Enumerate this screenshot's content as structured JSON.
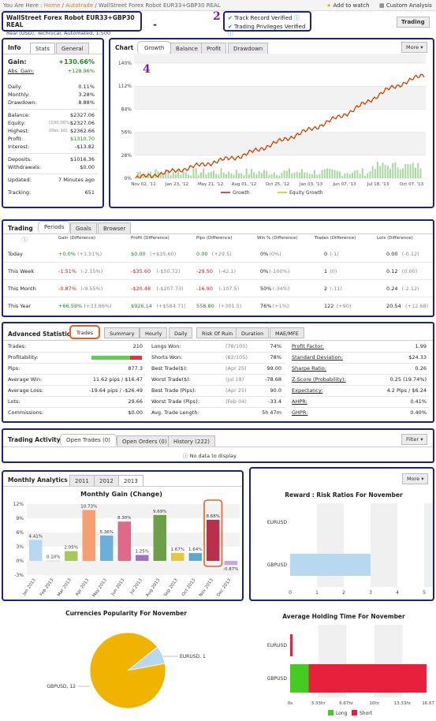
{
  "breadcrumb": {
    "prefix": "You Are Here :",
    "home": "Home",
    "section": "Autotrade",
    "current": "WallStreet Forex Robot EUR33+GBP30 REAL"
  },
  "header_actions": {
    "watch": "Add to watch",
    "custom": "Custom Analysis",
    "trading_btn": "Trading"
  },
  "account": {
    "name": "WallStreet Forex Robot EUR33+GBP30 REAL",
    "details": "Real (USD), Technical, Automated, 1:500"
  },
  "verification": {
    "track": "Track Record Verified",
    "privileges": "Trading Privileges Verified",
    "info": "?"
  },
  "annotations": {
    "a1": "-",
    "a2": "2",
    "a4": "4"
  },
  "info": {
    "title": "Info",
    "tabs": [
      "Stats",
      "General"
    ],
    "gain_label": "Gain:",
    "gain_value": "+130.66%",
    "abs_label": "Abs. Gain:",
    "abs_value": "+128.96%",
    "rows": [
      {
        "label": "Daily:",
        "value": "0.11%"
      },
      {
        "label": "Monthly:",
        "value": "3.28%"
      },
      {
        "label": "Drawdown:",
        "value": "8.88%"
      },
      {
        "label": "Balance:",
        "value": "$2327.06"
      },
      {
        "label": "Equity:",
        "note": "(100.00%)",
        "value": "$2327.06"
      },
      {
        "label": "Highest:",
        "note": "(Dec 10)",
        "value": "$2362.66"
      },
      {
        "label": "Profit:",
        "value": "$1310.70"
      },
      {
        "label": "Interest:",
        "value": "-$13.82"
      },
      {
        "label": "Deposits:",
        "value": "$1016.36"
      },
      {
        "label": "Withdrawals:",
        "value": "$0.00"
      },
      {
        "label": "Updated:",
        "value": "7 Minutes ago"
      },
      {
        "label": "Tracking:",
        "value": "651"
      }
    ]
  },
  "chart_panel": {
    "title": "Chart",
    "tabs": [
      "Growth",
      "Balance",
      "Profit",
      "Drawdown"
    ],
    "more": "More",
    "legend": [
      "Growth",
      "Equity Growth"
    ]
  },
  "chart_data": [
    {
      "type": "line",
      "title": "",
      "x": [
        "Nov 02, '11",
        "Jan 23, '12",
        "May 21, '12",
        "Aug 01, '12",
        "Oct 25, '12",
        "Jan 03, '13",
        "Jun 07, '13",
        "Jul 18, '13",
        "Oct 07, '13"
      ],
      "yticks": [
        "0%",
        "28%",
        "56%",
        "84%",
        "112%",
        "140%"
      ],
      "ylim": [
        0,
        140
      ],
      "series": [
        {
          "name": "Growth",
          "color": "#d01515",
          "values": [
            0,
            8,
            18,
            28,
            45,
            62,
            82,
            108,
            126
          ]
        },
        {
          "name": "Equity Growth",
          "color": "#f0b400",
          "values": [
            0,
            8,
            18,
            28,
            45,
            62,
            82,
            108,
            126
          ]
        }
      ]
    },
    {
      "type": "bar",
      "title": "Monthly Gain (Change)",
      "categories": [
        "Jan 2013",
        "Feb 2013",
        "Mar 2013",
        "Apr 2013",
        "May 2013",
        "Jun 2013",
        "Jul 2013",
        "Aug 2013",
        "Sep 2013",
        "Oct 2013",
        "Nov 2013",
        "Dec 2013"
      ],
      "values": [
        4.41,
        0.1,
        2.05,
        10.73,
        5.36,
        8.3,
        1.25,
        9.69,
        1.67,
        1.64,
        8.68,
        -0.87
      ],
      "labels": [
        "4.41%",
        "0.10%",
        "2.05%",
        "10.73%",
        "5.36%",
        "8.30%",
        "1.25%",
        "9.69%",
        "1.67%",
        "1.64%",
        "8.68%",
        "-0.87%"
      ],
      "colors": [
        "#b8d8f0",
        "#dcdcdc",
        "#a8c858",
        "#f4a070",
        "#6ab0d8",
        "#e06888",
        "#a070c8",
        "#6ca048",
        "#e8c838",
        "#58a8d0",
        "#b8304c",
        "#c8a8d8"
      ],
      "yticks": [
        "-3%",
        "0%",
        "3%",
        "6%",
        "9%",
        "12%"
      ],
      "ylim": [
        -3,
        12
      ]
    },
    {
      "type": "bar",
      "title": "Reward : Risk Ratios For November",
      "categories": [
        "EURUSD",
        "GBPUSD"
      ],
      "values": [
        0,
        3.0
      ],
      "xticks": [
        "0",
        "1",
        "2",
        "3",
        "4",
        "5"
      ],
      "xlim": [
        0,
        5
      ]
    },
    {
      "type": "pie",
      "title": "Currencies Popularity For November",
      "labels": [
        "EURUSD, 1",
        "GBPUSD, 12"
      ],
      "values": [
        1,
        12
      ],
      "colors": [
        "#b8d8f0",
        "#f0b400"
      ]
    },
    {
      "type": "bar",
      "title": "Average Holding Time For November",
      "categories": [
        "EURUSD",
        "GBPUSD"
      ],
      "series": [
        {
          "name": "Long",
          "color": "#44cc22",
          "values": [
            0,
            2.2
          ]
        },
        {
          "name": "Short",
          "color": "#e8203c",
          "values": [
            0.3,
            14.0
          ]
        }
      ],
      "xticks": [
        "0s",
        "3.33hr",
        "6.67hr",
        "10hr",
        "13.33hr",
        "16.67hr"
      ],
      "xlim": [
        0,
        16.67
      ]
    }
  ],
  "trading": {
    "title": "Trading",
    "tabs": [
      "Periods",
      "Goals",
      "Browser"
    ],
    "headers": [
      "Gain (Difference)",
      "Profit (Difference)",
      "Pips (Difference)",
      "Win % (Difference)",
      "Trades (Difference)",
      "Lots (Difference)"
    ],
    "rows": [
      {
        "period": "Today",
        "gain": "+0.0%",
        "gain_d": "(+1.51%)",
        "profit": "$0.00",
        "profit_d": "(+$35.60)",
        "pips": "0.00",
        "pips_d": "(+29.5)",
        "win": "0%",
        "win_d": "(0%)",
        "trades": "0",
        "trades_d": "(-1)",
        "lots": "0.00",
        "lots_d": "(-0.12)"
      },
      {
        "period": "This Week",
        "gain": "-1.51%",
        "gain_d": "(-2.15%)",
        "profit": "-$35.60",
        "profit_d": "(-$50.72)",
        "pips": "-29.50",
        "pips_d": "(-42.1)",
        "win": "0%",
        "win_d": "(-100%)",
        "trades": "1",
        "trades_d": "(0)",
        "lots": "0.12",
        "lots_d": "(0.00)"
      },
      {
        "period": "This Month",
        "gain": "-0.87%",
        "gain_d": "(-9.55%)",
        "profit": "-$20.48",
        "profit_d": "(-$207.73)",
        "pips": "-16.90",
        "pips_d": "(-107.5)",
        "win": "50%",
        "win_d": "(-34%)",
        "trades": "2",
        "trades_d": "(-11)",
        "lots": "0.24",
        "lots_d": "(-2.12)"
      },
      {
        "period": "This Year",
        "gain": "+66.59%",
        "gain_d": "(+33.86%)",
        "profit": "$926.14",
        "profit_d": "(+$584.71)",
        "pips": "558.80",
        "pips_d": "(+301.5)",
        "win": "76%",
        "win_d": "(+1%)",
        "trades": "122",
        "trades_d": "(+90)",
        "lots": "20.54",
        "lots_d": "(+12.68)"
      }
    ]
  },
  "advanced": {
    "title": "Advanced Statistics",
    "tabs": [
      "Trades",
      "Summary",
      "Hourly",
      "Daily",
      "Risk Of Ruin",
      "Duration",
      "MAE/MFE"
    ],
    "col1": [
      {
        "label": "Trades:",
        "value": "210"
      },
      {
        "label": "Profitability:",
        "value": ""
      },
      {
        "label": "Pips:",
        "value": "877.3"
      },
      {
        "label": "Average Win:",
        "value": "11.62 pips / $16.47"
      },
      {
        "label": "Average Loss:",
        "value": "-19.64 pips / -$26.49"
      },
      {
        "label": "Lots:",
        "value": "29.66"
      },
      {
        "label": "Commissions:",
        "value": "$0.00"
      }
    ],
    "col2": [
      {
        "label": "Longs Won:",
        "note": "(78/105)",
        "value": "74%"
      },
      {
        "label": "Shorts Won:",
        "note": "(82/105)",
        "value": "78%"
      },
      {
        "label": "Best Trade($):",
        "note": "(Apr 25)",
        "value": "99.00"
      },
      {
        "label": "Worst Trade($):",
        "note": "(Jul 18)",
        "value": "-78.68"
      },
      {
        "label": "Best Trade (Pips):",
        "note": "(Apr 25)",
        "value": "90.0"
      },
      {
        "label": "Worst Trade (Pips):",
        "note": "(Feb 04)",
        "value": "-33.4"
      },
      {
        "label": "Avg. Trade Length:",
        "note": "",
        "value": "5h 47m"
      }
    ],
    "col3": [
      {
        "label": "Profit Factor:",
        "value": "1.99"
      },
      {
        "label": "Standard Deviation:",
        "value": "$24.33"
      },
      {
        "label": "Sharpe Ratio:",
        "value": "0.26"
      },
      {
        "label": "Z-Score (Probability):",
        "value": "0.25 (19.74%)"
      },
      {
        "label": "Expectancy:",
        "value": "4.2 Pips / $6.24"
      },
      {
        "label": "AHPR:",
        "value": "0.41%"
      },
      {
        "label": "GHPR:",
        "value": "0.40%"
      }
    ],
    "profitability": 0.76
  },
  "activity": {
    "title": "Trading Activity",
    "tabs": [
      "Open Trades (0)",
      "Open Orders (0)",
      "History (222)"
    ],
    "filter": "Filter",
    "empty": "No data to display."
  },
  "monthly": {
    "title": "Monthly Analytics",
    "tabs": [
      "2011",
      "2012",
      "2013"
    ],
    "more": "More"
  },
  "legend_holding": [
    "Long",
    "Short"
  ]
}
